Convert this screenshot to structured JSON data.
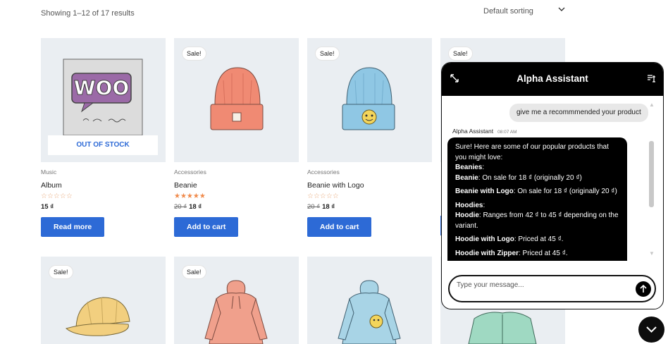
{
  "toolbar": {
    "result_count": "Showing 1–12 of 17 results",
    "sorting": "Default sorting"
  },
  "products": [
    {
      "category": "Music",
      "name": "Album",
      "badge": "",
      "stock_label": "OUT OF STOCK",
      "rating_label": "☆☆☆☆☆",
      "old_price": "",
      "price": "15 ₫",
      "button": "Read more"
    },
    {
      "category": "Accessories",
      "name": "Beanie",
      "badge": "Sale!",
      "stock_label": "",
      "rating_label": "★★★★★",
      "old_price": "20 ₫",
      "price": "18 ₫",
      "button": "Add to cart"
    },
    {
      "category": "Accessories",
      "name": "Beanie with Logo",
      "badge": "Sale!",
      "stock_label": "",
      "rating_label": "☆☆☆☆☆",
      "old_price": "20 ₫",
      "price": "18 ₫",
      "button": "Add to cart"
    },
    {
      "badge": "Sale!"
    },
    {
      "badge": "Sale!"
    },
    {
      "badge": "Sale!"
    }
  ],
  "chat": {
    "title": "Alpha Assistant",
    "user_message": "give me a recommmended your product",
    "bot_name": "Alpha Assistant",
    "bot_time": "08:07 AM",
    "bot_reply": {
      "intro": "Sure! Here are some of our popular products that you might love:",
      "beanies_heading": "Beanies",
      "beanie_label": "Beanie",
      "beanie_text": ": On sale for 18 ₫ (originally 20 ₫)",
      "beanie_logo_label": "Beanie with Logo",
      "beanie_logo_text": ": On sale for 18 ₫ (originally 20 ₫)",
      "hoodies_heading": "Hoodies",
      "hoodie_label": "Hoodie",
      "hoodie_text": ": Ranges from 42 ₫ to 45 ₫ depending on the variant.",
      "hoodie_logo_label": "Hoodie with Logo",
      "hoodie_logo_text": ": Priced at 45 ₫.",
      "hoodie_zipper_label": "Hoodie with Zipper",
      "hoodie_zipper_text": ": Priced at 45 ₫."
    },
    "input_placeholder": "Type your message..."
  },
  "icons": {
    "expand": "expand-icon",
    "clear": "clear-chat-icon",
    "send": "arrow-up-icon",
    "toggle": "chevron-down-icon"
  },
  "colors": {
    "accent": "#2d6ad6",
    "chat_header": "#000000",
    "thumb_bg": "#eaeef2"
  }
}
